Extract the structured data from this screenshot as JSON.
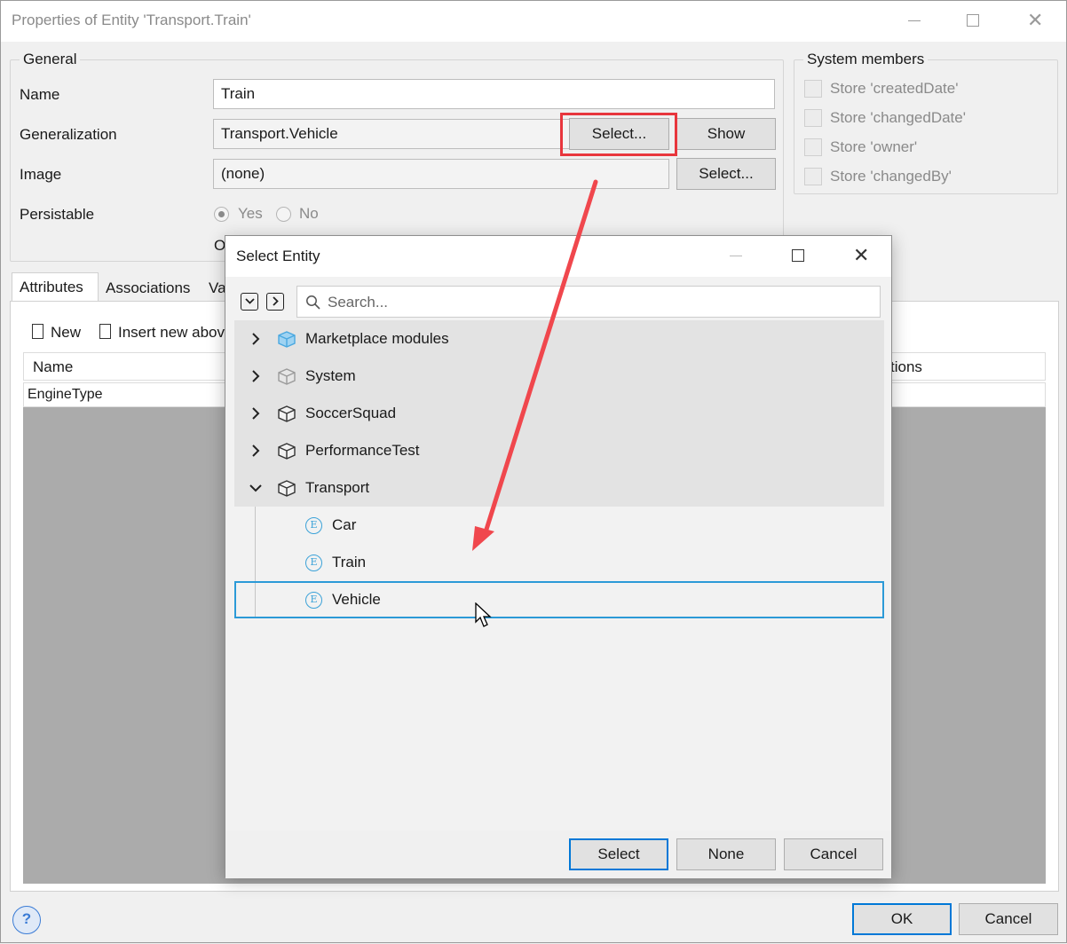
{
  "window": {
    "title": "Properties of Entity 'Transport.Train'"
  },
  "general": {
    "legend": "General",
    "name_label": "Name",
    "name_value": "Train",
    "generalization_label": "Generalization",
    "generalization_value": "Transport.Vehicle",
    "select_label": "Select...",
    "show_label": "Show",
    "image_label": "Image",
    "image_value": "(none)",
    "image_select_label": "Select...",
    "persistable_label": "Persistable",
    "yes_label": "Yes",
    "no_label": "No",
    "persistable_value": "Yes",
    "partial_text": "O"
  },
  "system_members": {
    "legend": "System members",
    "items": [
      {
        "label": "Store 'createdDate'"
      },
      {
        "label": "Store 'changedDate'"
      },
      {
        "label": "Store 'owner'"
      },
      {
        "label": "Store 'changedBy'"
      }
    ]
  },
  "tabs": [
    {
      "label": "Attributes",
      "active": true
    },
    {
      "label": "Associations",
      "active": false
    },
    {
      "label": "Va",
      "active": false
    }
  ],
  "attributes": {
    "new_label": "New",
    "insert_label": "Insert new abov",
    "col_name": "Name",
    "col_right": "tions",
    "row_value": "EngineType"
  },
  "dialog": {
    "title": "Select Entity",
    "search_placeholder": "Search...",
    "modules": [
      {
        "name": "Marketplace modules",
        "icon": "marketplace-module-icon",
        "expanded": false
      },
      {
        "name": "System",
        "icon": "system-module-icon",
        "expanded": false
      },
      {
        "name": "SoccerSquad",
        "icon": "module-icon",
        "expanded": false
      },
      {
        "name": "PerformanceTest",
        "icon": "module-icon",
        "expanded": false
      },
      {
        "name": "Transport",
        "icon": "module-icon",
        "expanded": true
      }
    ],
    "entities": [
      {
        "name": "Car",
        "badge": "E"
      },
      {
        "name": "Train",
        "badge": "E"
      },
      {
        "name": "Vehicle",
        "badge": "E",
        "selected": true
      }
    ],
    "select_label": "Select",
    "none_label": "None",
    "cancel_label": "Cancel"
  },
  "footer": {
    "help_label": "?",
    "ok_label": "OK",
    "cancel_label": "Cancel"
  },
  "colors": {
    "accent": "#0078d7",
    "selection": "#2c9ad7",
    "annotation_red": "#e8363d",
    "marketplace_blue": "#4aa8e0"
  }
}
